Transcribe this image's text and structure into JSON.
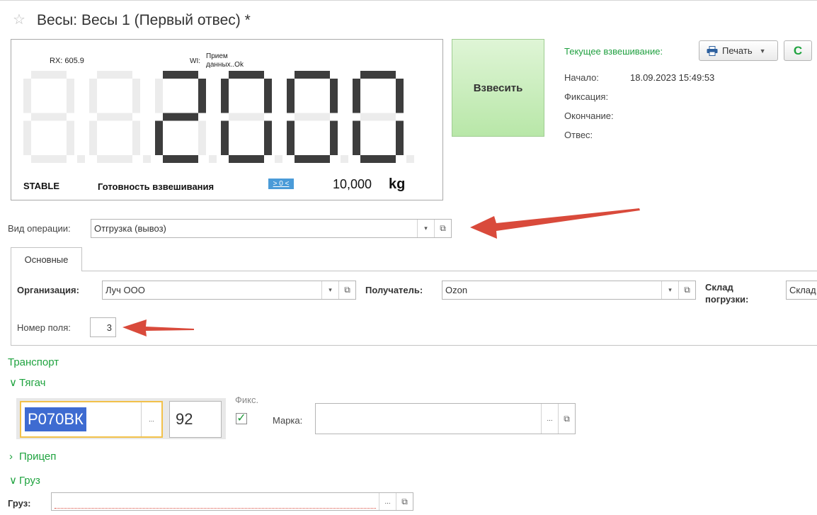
{
  "title": "Весы: Весы 1 (Первый отвес) *",
  "display": {
    "rx": "RX: 605.9",
    "wi_label": "WI:",
    "wi_value": "Прием данных..Ok",
    "digits": "2000",
    "stable": "STABLE",
    "ready_label": "Готовность взвешивания",
    "ready_badge": "> 0 <",
    "weight": "10,000",
    "unit": "kg"
  },
  "weigh_button": "Взвесить",
  "current": {
    "label": "Текущее взвешивание:",
    "print_label": "Печать",
    "start_label": "Начало:",
    "start_value": "18.09.2023 15:49:53",
    "fix_label": "Фиксация:",
    "end_label": "Окончание:",
    "otves_label": "Отвес:"
  },
  "operation": {
    "label": "Вид операции:",
    "value": "Отгрузка (вывоз)"
  },
  "tabs": [
    {
      "label": "Основные"
    }
  ],
  "main": {
    "org_label": "Организация:",
    "org_value": "Луч ООО",
    "recipient_label": "Получатель:",
    "recipient_value": "Ozon",
    "warehouse_label_1": "Склад",
    "warehouse_label_2": "погрузки:",
    "warehouse_value": "Склад",
    "field_no_label": "Номер поля:",
    "field_no_value": "3"
  },
  "transport": {
    "title": "Транспорт",
    "tractor": "Тягач",
    "plate": "Р070ВК",
    "region": "92",
    "fix_label": "Фикс.",
    "fix_checked": true,
    "brand_label": "Марка:",
    "brand_value": "",
    "trailer": "Прицеп",
    "cargo": "Груз",
    "cargo_label": "Груз:",
    "cargo_value": ""
  },
  "colors": {
    "accent_green": "#1fa33f",
    "arrow_red": "#d94a3b",
    "plate_highlight": "#3e6bd1"
  }
}
